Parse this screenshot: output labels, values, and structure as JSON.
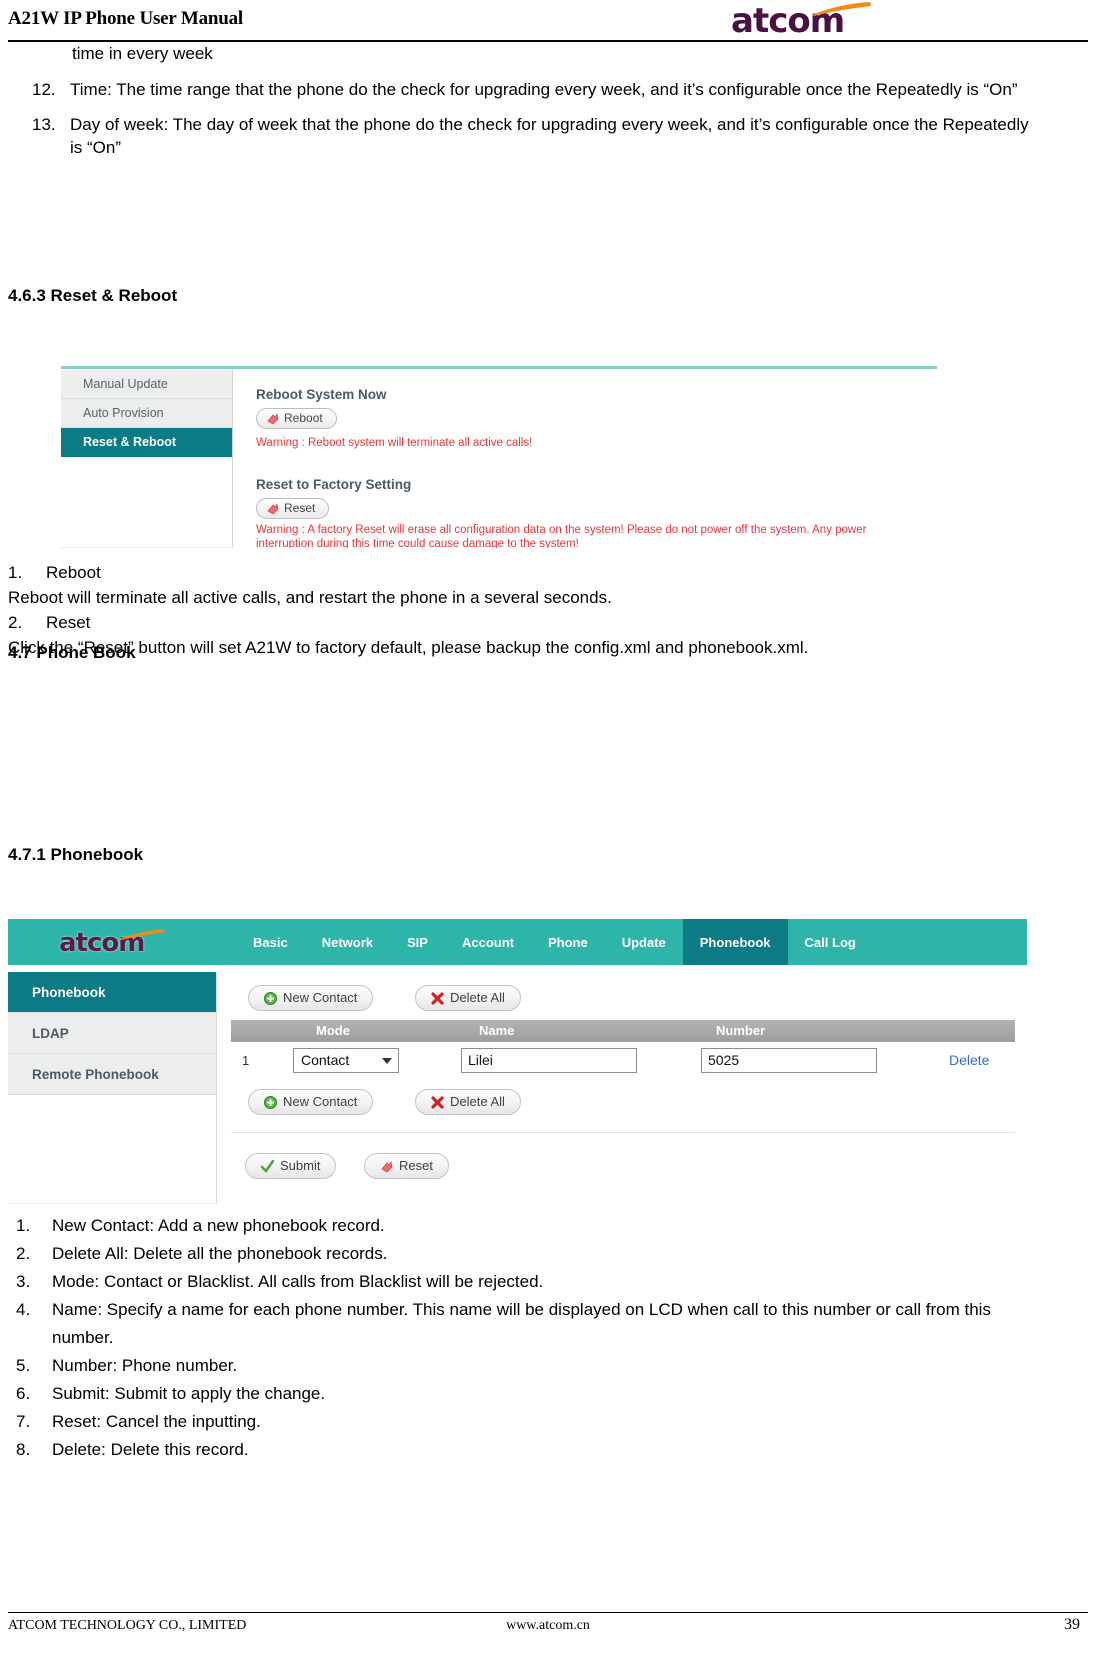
{
  "header": {
    "manual_title": "A21W IP Phone User Manual",
    "logo_text": "atcom"
  },
  "body": {
    "continued_line": "time in every week",
    "top_list": [
      {
        "num": "12.",
        "text": "Time: The time range that the phone do the check for upgrading every week, and it’s configurable once the Repeatedly is “On”"
      },
      {
        "num": "13.",
        "text": "Day of week: The day of week that the phone do the check for upgrading every week, and it’s configurable once the Repeatedly is “On”"
      }
    ],
    "section_463": "4.6.3 Reset & Reboot",
    "section_47": "4.7 Phone Book",
    "section_471": "4.7.1 Phonebook",
    "reboot_block": {
      "item1_num": "1.",
      "item1_label": "Reboot",
      "item1_desc": "Reboot will terminate all active calls, and restart the phone in a several seconds.",
      "item2_num": "2.",
      "item2_label": "Reset",
      "item2_desc": "Click the “Reset” button will set A21W to factory default, please backup the config.xml and phonebook.xml."
    },
    "phonebook_list": [
      {
        "num": "1.",
        "text": "New Contact: Add a new phonebook record."
      },
      {
        "num": "2.",
        "text": "Delete All: Delete all the phonebook records."
      },
      {
        "num": "3.",
        "text": "Mode: Contact or Blacklist. All calls from Blacklist will be rejected."
      },
      {
        "num": "4.",
        "text": "Name: Specify a name for each phone number. This name will be displayed on LCD when call to this number or call from this number."
      },
      {
        "num": "5.",
        "text": "Number: Phone number."
      },
      {
        "num": "6.",
        "text": "Submit: Submit to apply the change."
      },
      {
        "num": "7.",
        "text": "Reset: Cancel the inputting."
      },
      {
        "num": "8.",
        "text": "Delete: Delete this record."
      }
    ]
  },
  "screenshot_reset_reboot": {
    "sidebar": [
      {
        "label": "Manual Update",
        "active": false
      },
      {
        "label": "Auto Provision",
        "active": false
      },
      {
        "label": "Reset & Reboot",
        "active": true
      }
    ],
    "heading_reboot": "Reboot System Now",
    "reboot_button": "Reboot",
    "reboot_warning": "Warning : Reboot system will terminate all active calls!",
    "heading_reset": "Reset to Factory Setting",
    "reset_button": "Reset",
    "reset_warning": "Warning : A factory Reset will erase all configuration data on the system! Please do not power off the system. Any power interruption during this time could cause damage to the system!",
    "colors": {
      "active_teal": "#0b7c85",
      "warning_red": "#f0353b",
      "top_rule": "#2aa198"
    }
  },
  "screenshot_phonebook": {
    "logo_text": "atcom",
    "nav_tabs": [
      {
        "label": "Basic",
        "active": false
      },
      {
        "label": "Network",
        "active": false
      },
      {
        "label": "SIP",
        "active": false
      },
      {
        "label": "Account",
        "active": false
      },
      {
        "label": "Phone",
        "active": false
      },
      {
        "label": "Update",
        "active": false
      },
      {
        "label": "Phonebook",
        "active": true
      },
      {
        "label": "Call Log",
        "active": false
      }
    ],
    "sidebar": [
      {
        "label": "Phonebook",
        "active": true
      },
      {
        "label": "LDAP",
        "active": false
      },
      {
        "label": "Remote Phonebook",
        "active": false
      }
    ],
    "buttons": {
      "new_contact": "New Contact",
      "delete_all": "Delete All",
      "submit": "Submit",
      "reset": "Reset"
    },
    "table": {
      "columns": [
        "Mode",
        "Name",
        "Number"
      ],
      "rows": [
        {
          "index": "1",
          "mode": "Contact",
          "name": "Lilei",
          "number": "5025",
          "delete": "Delete"
        }
      ]
    },
    "colors": {
      "nav_teal": "#2cb5a8",
      "active_teal": "#0c7b85",
      "link_blue": "#2f6fd0"
    }
  },
  "footer": {
    "left": "ATCOM TECHNOLOGY CO., LIMITED",
    "center": "www.atcom.cn",
    "page_number": "39"
  }
}
